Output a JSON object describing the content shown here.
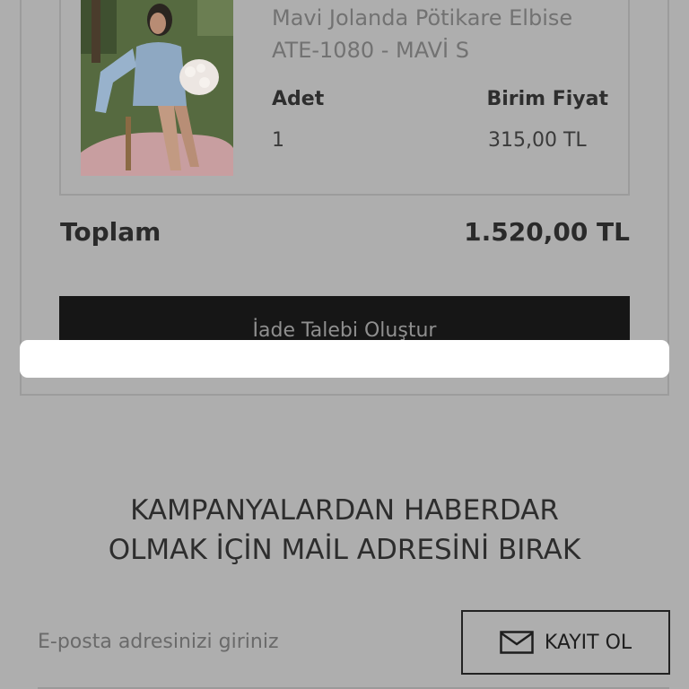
{
  "order_item": {
    "name_line1": "Mavi Jolanda Pötikare Elbise",
    "name_line2": "ATE-1080 - MAVİ S",
    "qty_label": "Adet",
    "qty_value": "1",
    "price_label": "Birim Fiyat",
    "price_value": "315,00 TL",
    "image_icon": "product-photo-woman-blue-dress"
  },
  "summary": {
    "total_label": "Toplam",
    "total_value": "1.520,00 TL"
  },
  "actions": {
    "return_request_label": "İade Talebi Oluştur"
  },
  "newsletter": {
    "title_line1": "KAMPANYALARDAN HABERDAR",
    "title_line2": "OLMAK İÇİN MAİL ADRESİNİ BIRAK",
    "email_placeholder": "E-posta adresinizi giriniz",
    "email_value": "",
    "signup_label": "KAYIT OL",
    "signup_icon": "envelope-icon"
  },
  "colors": {
    "overlay_background": "#aeaeae",
    "button_dark": "#161616",
    "toast": "#ffffff"
  }
}
